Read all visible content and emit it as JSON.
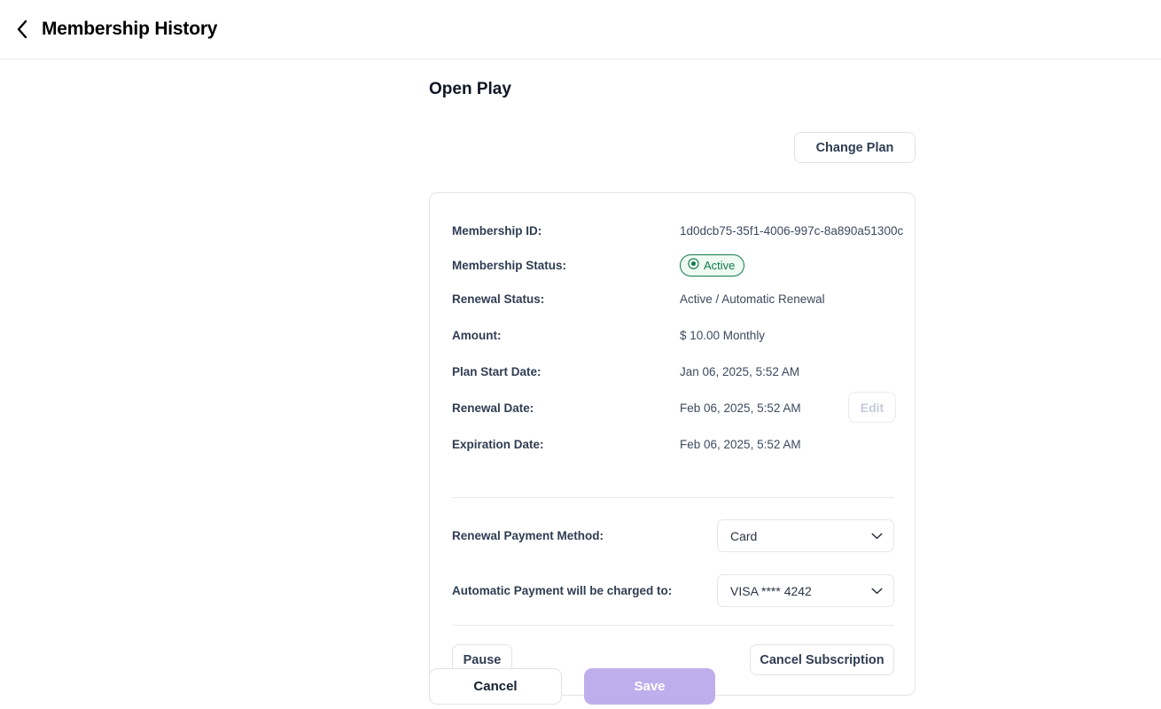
{
  "header": {
    "back_icon": "chevron-left-icon",
    "title": "Membership History"
  },
  "main": {
    "plan_name": "Open Play",
    "change_plan_label": "Change Plan",
    "details": [
      {
        "label": "Membership ID:",
        "value": "1d0dcb75-35f1-4006-997c-8a890a51300c"
      },
      {
        "label": "Membership Status:",
        "value": "Active"
      },
      {
        "label": "Renewal Status:",
        "value": "Active / Automatic Renewal"
      },
      {
        "label": "Amount:",
        "value": "$ 10.00 Monthly"
      },
      {
        "label": "Plan Start Date:",
        "value": "Jan 06, 2025, 5:52 AM"
      },
      {
        "label": "Renewal Date:",
        "value": "Feb 06, 2025, 5:52 AM"
      },
      {
        "label": "Expiration Date:",
        "value": "Feb 06, 2025, 5:52 AM"
      }
    ],
    "status_badge": {
      "text": "Active",
      "icon": "radio-dot-icon",
      "color": "#117a4b",
      "background": "#effaf3"
    },
    "edit_label": "Edit",
    "renewal_payment_method": {
      "label": "Renewal Payment Method:",
      "value": "Card",
      "icon": "chevron-down-icon"
    },
    "automatic_payment": {
      "label": "Automatic Payment will be charged to:",
      "value": "VISA **** 4242",
      "icon": "chevron-down-icon"
    },
    "pause_label": "Pause",
    "cancel_subscription_label": "Cancel Subscription"
  },
  "footer": {
    "cancel_label": "Cancel",
    "save_label": "Save",
    "save_color": "#bfaeec"
  }
}
